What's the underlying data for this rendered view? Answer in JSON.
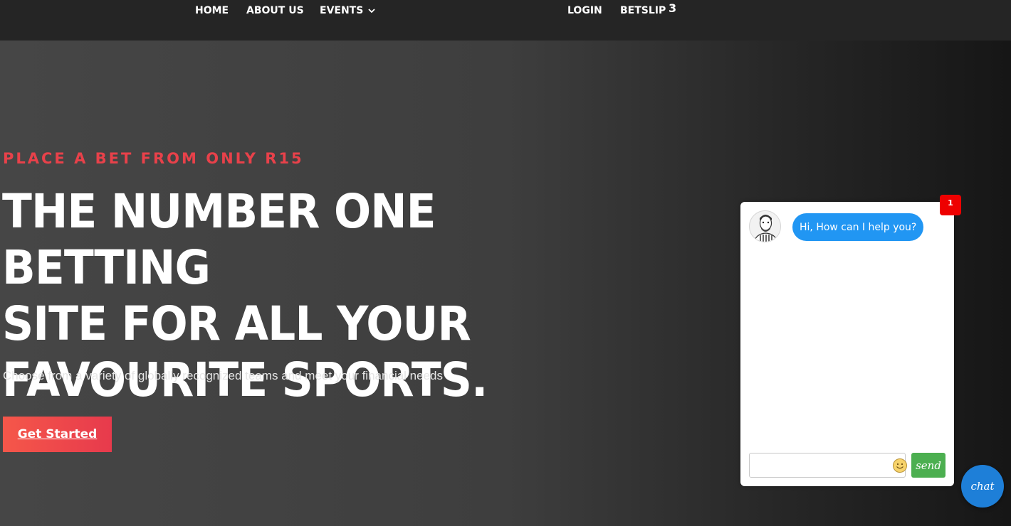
{
  "nav": {
    "home": "HOME",
    "about": "ABOUT US",
    "events": "EVENTS",
    "login": "LOGIN",
    "betslip": "BETSLIP",
    "betslip_count": "3"
  },
  "hero": {
    "tagline": "PLACE A BET FROM ONLY R15",
    "title_lines": [
      "THE NUMBER ONE BETTING",
      "SITE FOR ALL YOUR",
      "FAVOURITE SPORTS."
    ],
    "subtitle": "Choose from a variety of globally recognized teams and meet your financial needs",
    "cta_label": "Get Started"
  },
  "chat": {
    "greeting": "Hi, How can I help you?",
    "unread_count": "1",
    "input_placeholder": "",
    "send_label": "send",
    "fab_label": "chat"
  },
  "colors": {
    "accent": "#e8414a",
    "bubble": "#2196f3",
    "send": "#4caf50",
    "fab": "#1e7fd8",
    "badge": "#ee0000"
  },
  "icons": {
    "events_dropdown": "chevron-down-icon",
    "emoji": "smiley-icon",
    "agent": "avatar-icon"
  }
}
